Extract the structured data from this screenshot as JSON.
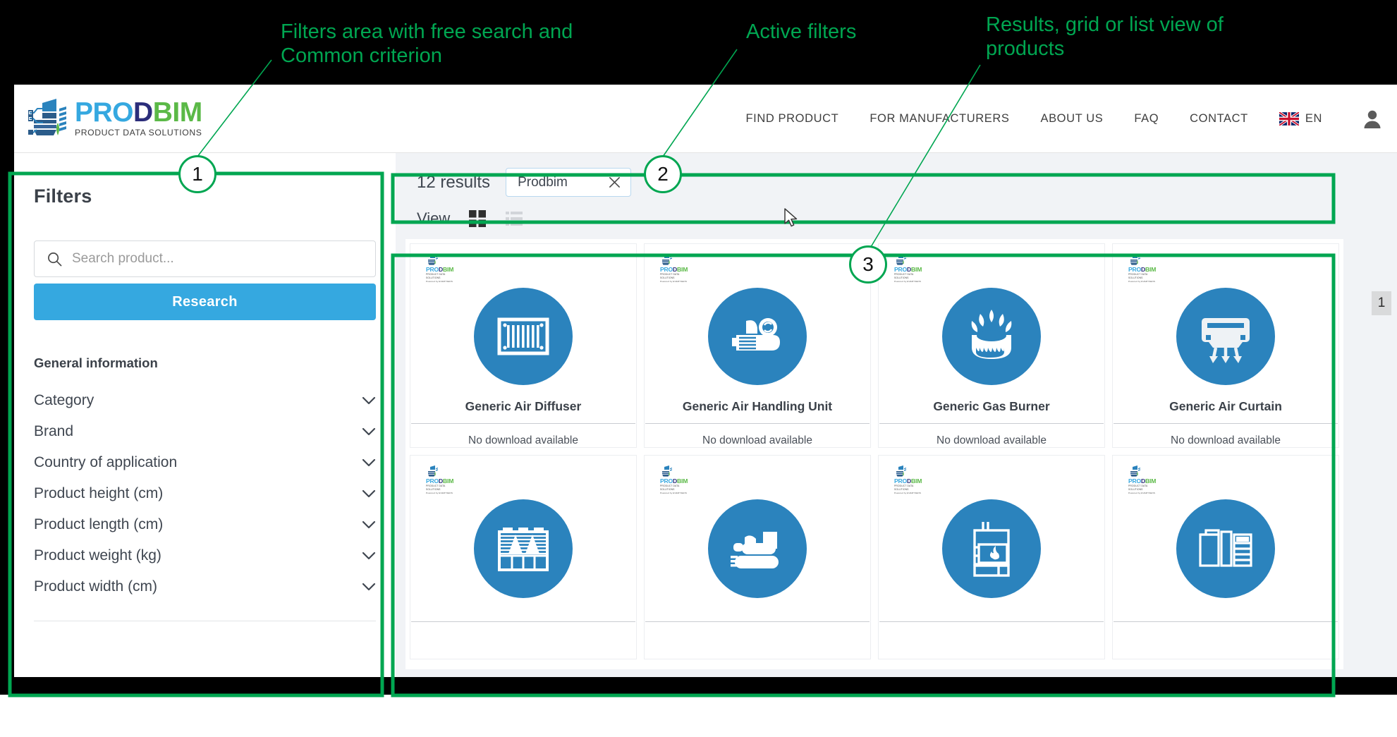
{
  "annotations": {
    "note_filters": "Filters area with free search and\nCommon criterion",
    "note_active_filters": "Active filters",
    "note_results": "Results, grid or list view of\nproducts",
    "callout_1": "1",
    "callout_2": "2",
    "callout_3": "3",
    "accent_color": "#00a651"
  },
  "header": {
    "logo": {
      "word_pro": "PRO",
      "word_d": "D",
      "word_bim": "BIM",
      "tagline": "PRODUCT DATA SOLUTIONS",
      "color_pro": "#35a8e0",
      "color_d": "#2b2d7a",
      "color_bim": "#5bb947"
    },
    "nav": [
      {
        "label": "FIND PRODUCT"
      },
      {
        "label": "FOR MANUFACTURERS"
      },
      {
        "label": "ABOUT US"
      },
      {
        "label": "FAQ"
      },
      {
        "label": "CONTACT"
      }
    ],
    "language": {
      "code": "EN",
      "flag": "uk-flag-icon"
    },
    "account_icon": "person-icon"
  },
  "sidebar": {
    "title": "Filters",
    "search": {
      "placeholder": "Search product...",
      "value": "",
      "icon": "search-icon"
    },
    "research_button": "Research",
    "group_title": "General information",
    "filters": [
      {
        "label": "Category"
      },
      {
        "label": "Brand"
      },
      {
        "label": "Country of application"
      },
      {
        "label": "Product height (cm)"
      },
      {
        "label": "Product length (cm)"
      },
      {
        "label": "Product weight (kg)"
      },
      {
        "label": "Product width (cm)"
      }
    ]
  },
  "results": {
    "count_label": "12 results",
    "active_chips": [
      {
        "label": "Prodbim",
        "remove_icon": "close-icon"
      }
    ],
    "view": {
      "label": "View",
      "grid_active": true,
      "grid_icon": "grid-view-icon",
      "list_icon": "list-view-icon"
    },
    "page_indicator": "1",
    "cards": [
      {
        "name": "Generic Air Diffuser",
        "download": "No download available",
        "icon": "air-diffuser-icon"
      },
      {
        "name": "Generic Air Handling Unit",
        "download": "No download available",
        "icon": "air-handling-unit-icon"
      },
      {
        "name": "Generic Gas Burner",
        "download": "No download available",
        "icon": "gas-burner-icon"
      },
      {
        "name": "Generic Air Curtain",
        "download": "No download available",
        "icon": "air-curtain-icon"
      },
      {
        "name": "",
        "download": "",
        "icon": "cooling-tower-icon"
      },
      {
        "name": "",
        "download": "",
        "icon": "chiller-icon"
      },
      {
        "name": "",
        "download": "",
        "icon": "boiler-icon"
      },
      {
        "name": "",
        "download": "",
        "icon": "cabinet-icon"
      }
    ],
    "card_logo": {
      "word_pro": "PRO",
      "word_d": "D",
      "word_bim": "BIM",
      "tagline": "PRODUCT DATA SOLUTIONS",
      "powered": "Powered by EVERYSENS"
    },
    "circle_color": "#2b83bd"
  }
}
